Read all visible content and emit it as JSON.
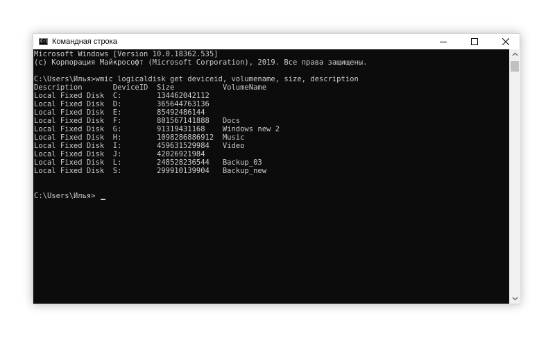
{
  "window": {
    "title": "Командная строка",
    "icon_label": "C:\\",
    "icons": {
      "app": "cmd-icon",
      "minimize": "minimize-icon",
      "maximize": "maximize-icon",
      "close": "close-icon"
    }
  },
  "console": {
    "lines": [
      "Microsoft Windows [Version 10.0.18362.535]",
      "(c) Корпорация Майкрософт (Microsoft Corporation), 2019. Все права защищены.",
      "",
      "C:\\Users\\Илья>wmic logicaldisk get deviceid, volumename, size, description",
      "Description       DeviceID  Size           VolumeName",
      "Local Fixed Disk  C:        134462042112",
      "Local Fixed Disk  D:        365644763136",
      "Local Fixed Disk  E:        85492486144",
      "Local Fixed Disk  F:        801567141888   Docs",
      "Local Fixed Disk  G:        91319431168    Windows new 2",
      "Local Fixed Disk  H:        1098286886912  Music",
      "Local Fixed Disk  I:        459631529984   Video",
      "Local Fixed Disk  J:        42026921984",
      "Local Fixed Disk  L:        248528236544   Backup_03",
      "Local Fixed Disk  S:        299910139904   Backup_new",
      "",
      "",
      "C:\\Users\\Илья>"
    ]
  },
  "scrollbar": {
    "icons": {
      "up": "scroll-up-arrow-icon",
      "down": "scroll-down-arrow-icon"
    }
  },
  "colors": {
    "console_bg": "#0c0c0c",
    "console_text": "#cccccc",
    "titlebar_bg": "#ffffff",
    "scrollbar_bg": "#f0f0f0",
    "scroll_thumb": "#c1c1c1"
  }
}
